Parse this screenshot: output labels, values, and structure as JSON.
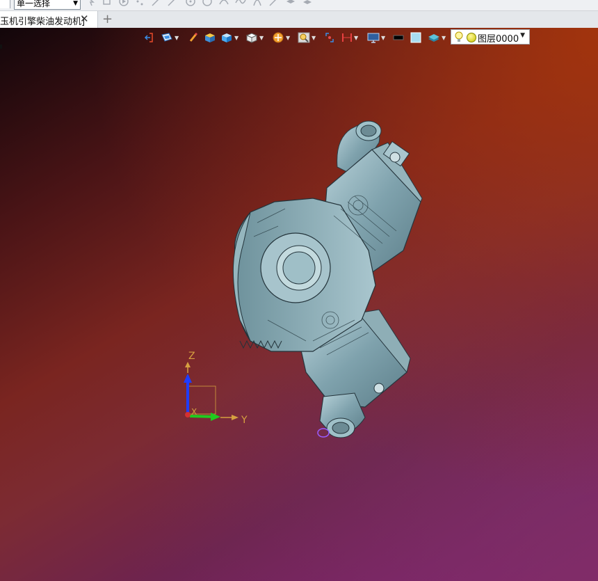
{
  "toolbar": {
    "selection_filter": "单一选择"
  },
  "tabs": {
    "document_label": "玉机引擎柴油发动机]",
    "close_symbol": "✕",
    "new_tab_symbol": "+"
  },
  "view_toolbar": {
    "icons": [
      "exit-icon",
      "render-style-icon",
      "pencil-icon",
      "shaded-box-icon",
      "view-cube-icon",
      "orient-view-icon",
      "clip-icon",
      "lighting-icon",
      "fit-icon",
      "section-icon",
      "display-icon",
      "black-bar-icon",
      "blank-square-icon",
      "layers-icon"
    ],
    "layer_value": "图层0000"
  },
  "triad": {
    "z_label": "Z",
    "y_label": "Y",
    "x_label": "X",
    "colors": {
      "z": "#1f3cff",
      "y": "#1fcc1f",
      "x": "#d43030",
      "label": "#d6a040"
    }
  },
  "viewport": {
    "gradient_colors": [
      "#12060a",
      "#a8380c",
      "#7e1f6d"
    ],
    "model_color": "#8fb3bd"
  }
}
